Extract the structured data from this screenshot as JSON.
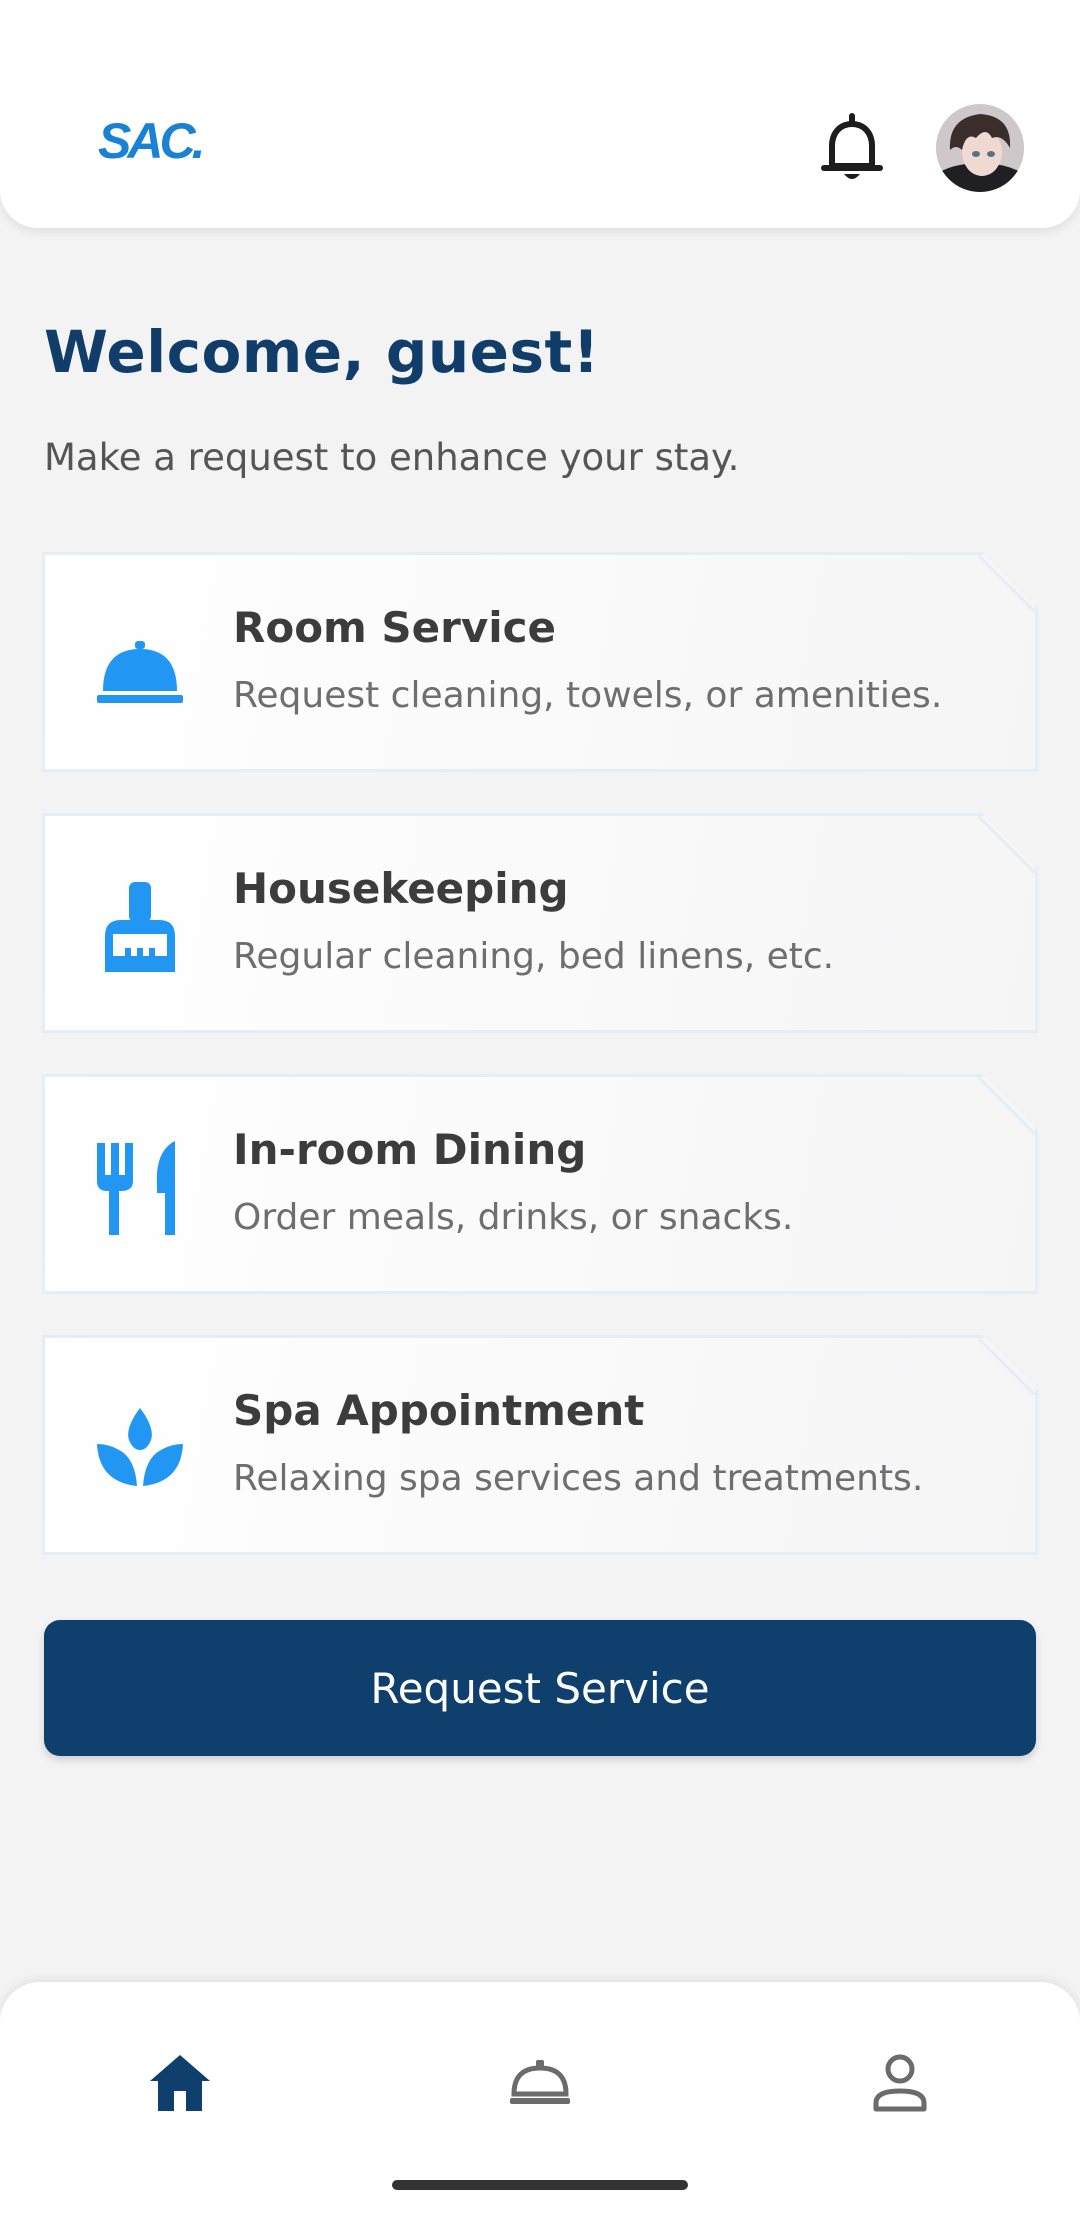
{
  "header": {
    "logo_text": "SAC.",
    "notification_icon": "bell-icon",
    "avatar_icon": "user-avatar"
  },
  "greeting": {
    "title": "Welcome, guest!",
    "subtitle": "Make a request to enhance your stay."
  },
  "services": [
    {
      "icon": "room-service-bell-icon",
      "title": "Room Service",
      "description": "Request cleaning, towels, or amenities."
    },
    {
      "icon": "broom-icon",
      "title": "Housekeeping",
      "description": "Regular cleaning, bed linens, etc."
    },
    {
      "icon": "fork-knife-icon",
      "title": "In-room Dining",
      "description": "Order meals, drinks, or snacks."
    },
    {
      "icon": "spa-lotus-icon",
      "title": "Spa Appointment",
      "description": "Relaxing spa services and treatments."
    }
  ],
  "actions": {
    "request_label": "Request Service"
  },
  "bottom_nav": {
    "items": [
      {
        "icon": "home-icon",
        "active": true
      },
      {
        "icon": "room-service-icon",
        "active": false
      },
      {
        "icon": "profile-icon",
        "active": false
      }
    ]
  },
  "colors": {
    "brand": "#1a82d4",
    "primary_dark": "#0e3f6d",
    "accent_icon": "#2196f3",
    "background": "#f3f3f4"
  }
}
